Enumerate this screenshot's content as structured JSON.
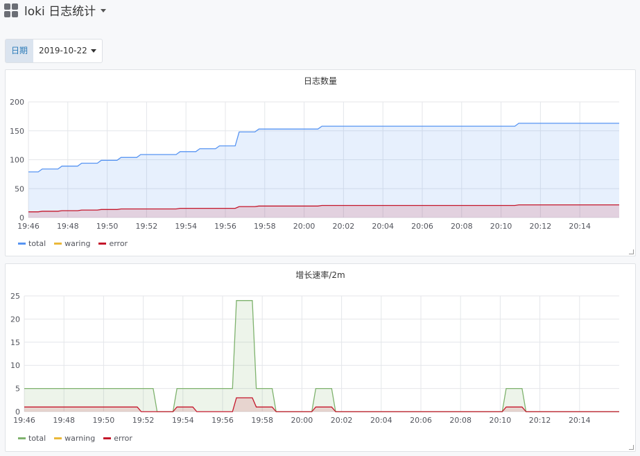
{
  "dashboard": {
    "title": "loki 日志统计",
    "icon": "dashboard-grid-icon"
  },
  "variable": {
    "label": "日期",
    "value": "2019-10-22"
  },
  "colors": {
    "total": "#7eb26d",
    "total_blue": "#5794f2",
    "warning": "#eab839",
    "error": "#c4162a"
  },
  "chart_data": [
    {
      "type": "area",
      "title": "日志数量",
      "ylim": [
        0,
        200
      ],
      "yticks": [
        0,
        50,
        100,
        150,
        200
      ],
      "xrange": [
        "19:46",
        "20:16"
      ],
      "xticks": [
        "19:46",
        "19:48",
        "19:50",
        "19:52",
        "19:54",
        "19:56",
        "19:58",
        "20:00",
        "20:02",
        "20:04",
        "20:06",
        "20:08",
        "20:10",
        "20:12",
        "20:14"
      ],
      "grid": true,
      "legend_position": "bottom-left",
      "series": [
        {
          "name": "total",
          "color": "#5794f2",
          "points": [
            [
              "19:46",
              79
            ],
            [
              "19:46.5",
              79
            ],
            [
              "19:46.7",
              84
            ],
            [
              "19:47.5",
              84
            ],
            [
              "19:47.7",
              89
            ],
            [
              "19:48.5",
              89
            ],
            [
              "19:48.7",
              94
            ],
            [
              "19:49.5",
              94
            ],
            [
              "19:49.7",
              99
            ],
            [
              "19:50.5",
              99
            ],
            [
              "19:50.7",
              104
            ],
            [
              "19:51.5",
              104
            ],
            [
              "19:51.7",
              109
            ],
            [
              "19:53.5",
              109
            ],
            [
              "19:53.7",
              114
            ],
            [
              "19:54.5",
              114
            ],
            [
              "19:54.7",
              119
            ],
            [
              "19:55.5",
              119
            ],
            [
              "19:55.7",
              124
            ],
            [
              "19:56.5",
              124
            ],
            [
              "19:56.7",
              148
            ],
            [
              "19:57.5",
              148
            ],
            [
              "19:57.7",
              153
            ],
            [
              "20:00.7",
              153
            ],
            [
              "20:00.9",
              158
            ],
            [
              "20:10.7",
              158
            ],
            [
              "20:10.9",
              163
            ],
            [
              "20:16",
              163
            ]
          ]
        },
        {
          "name": "waring",
          "color": "#eab839",
          "points": []
        },
        {
          "name": "error",
          "color": "#c4162a",
          "points": [
            [
              "19:46",
              10
            ],
            [
              "19:46.5",
              10
            ],
            [
              "19:46.7",
              11
            ],
            [
              "19:47.5",
              11
            ],
            [
              "19:47.7",
              12
            ],
            [
              "19:48.5",
              12
            ],
            [
              "19:48.7",
              13
            ],
            [
              "19:49.5",
              13
            ],
            [
              "19:49.7",
              14
            ],
            [
              "19:50.5",
              14
            ],
            [
              "19:50.7",
              15
            ],
            [
              "19:53.5",
              15
            ],
            [
              "19:53.7",
              16
            ],
            [
              "19:56.5",
              16
            ],
            [
              "19:56.7",
              19
            ],
            [
              "19:57.5",
              19
            ],
            [
              "19:57.7",
              20
            ],
            [
              "20:00.7",
              20
            ],
            [
              "20:00.9",
              21
            ],
            [
              "20:10.7",
              21
            ],
            [
              "20:10.9",
              22
            ],
            [
              "20:16",
              22
            ]
          ]
        }
      ]
    },
    {
      "type": "area",
      "title": "增长速率/2m",
      "ylim": [
        0,
        25
      ],
      "yticks": [
        0,
        5,
        10,
        15,
        20,
        25
      ],
      "xrange": [
        "19:46",
        "20:16"
      ],
      "xticks": [
        "19:46",
        "19:48",
        "19:50",
        "19:52",
        "19:54",
        "19:56",
        "19:58",
        "20:00",
        "20:02",
        "20:04",
        "20:06",
        "20:08",
        "20:10",
        "20:12",
        "20:14"
      ],
      "grid": true,
      "legend_position": "bottom-left",
      "series": [
        {
          "name": "total",
          "color": "#7eb26d",
          "points": [
            [
              "19:46",
              5
            ],
            [
              "19:52.5",
              5
            ],
            [
              "19:52.7",
              0
            ],
            [
              "19:53.5",
              0
            ],
            [
              "19:53.7",
              5
            ],
            [
              "19:56.5",
              5
            ],
            [
              "19:56.7",
              24
            ],
            [
              "19:57.5",
              24
            ],
            [
              "19:57.7",
              5
            ],
            [
              "19:58.5",
              5
            ],
            [
              "19:58.7",
              0
            ],
            [
              "20:00.5",
              0
            ],
            [
              "20:00.7",
              5
            ],
            [
              "20:01.5",
              5
            ],
            [
              "20:01.7",
              0
            ],
            [
              "20:10.1",
              0
            ],
            [
              "20:10.3",
              5
            ],
            [
              "20:11.1",
              5
            ],
            [
              "20:11.3",
              0
            ],
            [
              "20:16",
              0
            ]
          ]
        },
        {
          "name": "warning",
          "color": "#eab839",
          "points": []
        },
        {
          "name": "error",
          "color": "#c4162a",
          "points": [
            [
              "19:46",
              1
            ],
            [
              "19:51.7",
              1
            ],
            [
              "19:51.9",
              0
            ],
            [
              "19:53.5",
              0
            ],
            [
              "19:53.7",
              1
            ],
            [
              "19:54.5",
              1
            ],
            [
              "19:54.7",
              0
            ],
            [
              "19:56.5",
              0
            ],
            [
              "19:56.7",
              3
            ],
            [
              "19:57.5",
              3
            ],
            [
              "19:57.7",
              1
            ],
            [
              "19:58.5",
              1
            ],
            [
              "19:58.7",
              0
            ],
            [
              "20:00.5",
              0
            ],
            [
              "20:00.7",
              1
            ],
            [
              "20:01.5",
              1
            ],
            [
              "20:01.7",
              0
            ],
            [
              "20:10.1",
              0
            ],
            [
              "20:10.3",
              1
            ],
            [
              "20:11.1",
              1
            ],
            [
              "20:11.3",
              0
            ],
            [
              "20:16",
              0
            ]
          ]
        }
      ]
    }
  ]
}
